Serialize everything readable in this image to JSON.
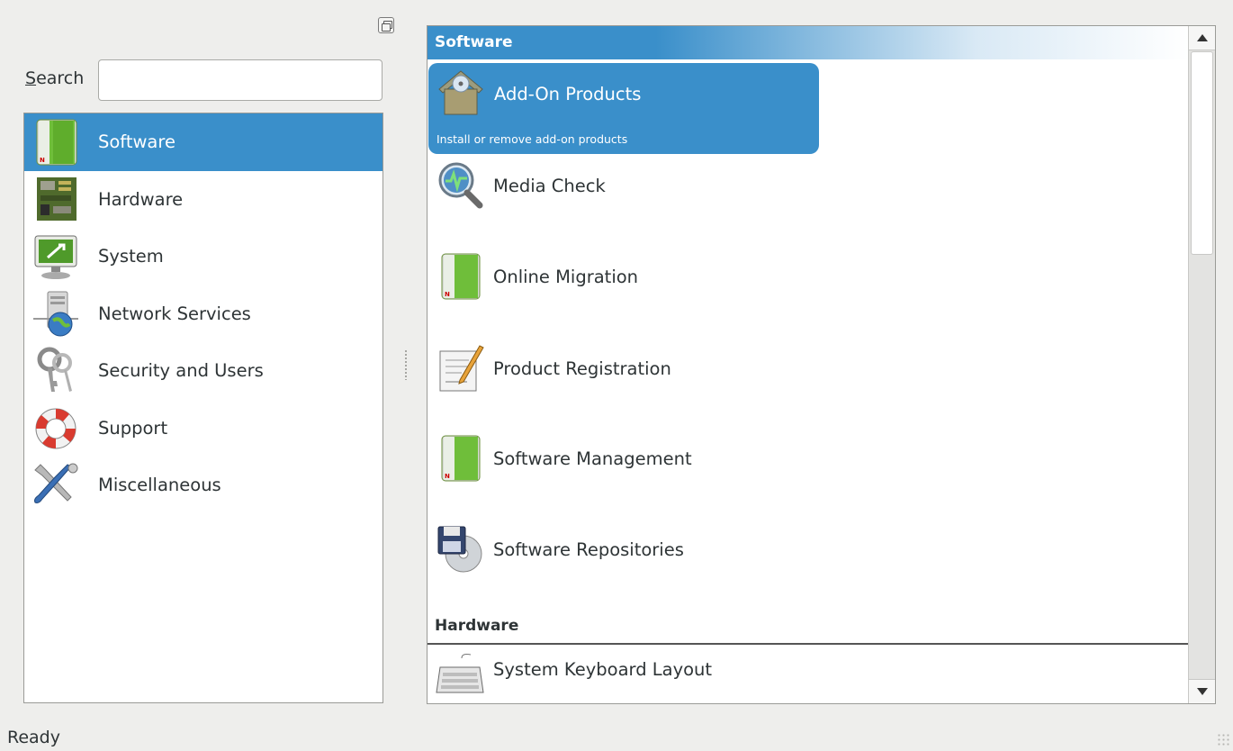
{
  "search": {
    "label_underlined": "S",
    "label_rest": "earch",
    "value": "",
    "placeholder": ""
  },
  "categories": [
    {
      "label": "Software",
      "icon": "software-icon",
      "selected": true
    },
    {
      "label": "Hardware",
      "icon": "hardware-icon"
    },
    {
      "label": "System",
      "icon": "system-icon"
    },
    {
      "label": "Network Services",
      "icon": "network-services-icon"
    },
    {
      "label": "Security and Users",
      "icon": "keys-icon"
    },
    {
      "label": "Support",
      "icon": "lifebuoy-icon"
    },
    {
      "label": "Miscellaneous",
      "icon": "tools-icon"
    }
  ],
  "groups": [
    {
      "title": "Software",
      "items": [
        {
          "label": "Add-On Products",
          "description": "Install or remove add-on products",
          "icon": "add-on-products-icon",
          "selected": true
        },
        {
          "label": "Media Check",
          "icon": "media-check-icon"
        },
        {
          "label": "Online Migration",
          "icon": "online-migration-icon"
        },
        {
          "label": "Product Registration",
          "icon": "product-registration-icon"
        },
        {
          "label": "Software Management",
          "icon": "software-management-icon"
        },
        {
          "label": "Software Repositories",
          "icon": "software-repositories-icon"
        }
      ]
    },
    {
      "title": "Hardware",
      "items": [
        {
          "label": "System Keyboard Layout",
          "icon": "keyboard-icon"
        }
      ]
    }
  ],
  "status": "Ready",
  "colors": {
    "selection": "#3a8fca",
    "window_bg": "#eeeeec",
    "list_bg": "#ffffff",
    "text": "#2e3436"
  }
}
